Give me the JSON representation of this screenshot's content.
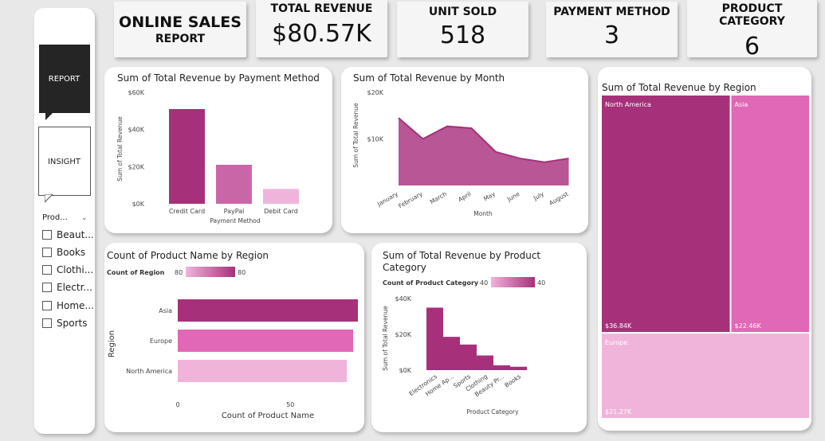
{
  "nav": {
    "report_label": "REPORT",
    "insight_label": "INSIGHT"
  },
  "slicer": {
    "header": "Prod...",
    "items": [
      "Beaut...",
      "Books",
      "Clothi...",
      "Electr...",
      "Home...",
      "Sports"
    ]
  },
  "report_title": {
    "line1": "ONLINE SALES",
    "line2": "REPORT"
  },
  "kpis": [
    {
      "label": "TOTAL REVENUE",
      "value": "$80.57K"
    },
    {
      "label": "UNIT SOLD",
      "value": "518"
    },
    {
      "label": "PAYMENT METHOD",
      "value": "3"
    },
    {
      "label": "PRODUCT CATEGORY",
      "value": "6"
    }
  ],
  "colors": {
    "dark": "#a6317a",
    "mid": "#e068b6",
    "light": "#f0b4db",
    "medium": "#c966a8"
  },
  "chart_data": [
    {
      "type": "bar",
      "title": "Sum of Total Revenue by Payment Method",
      "xlabel": "Payment Method",
      "ylabel": "Sum of Total Revenue",
      "categories": [
        "Credit Card",
        "PayPal",
        "Debit Card"
      ],
      "values": [
        51000,
        21000,
        8000
      ],
      "ylim": [
        0,
        60000
      ],
      "yticks": [
        "$0K",
        "$20K",
        "$40K",
        "$60K"
      ]
    },
    {
      "type": "area",
      "title": "Sum of Total Revenue by Month",
      "xlabel": "Month",
      "ylabel": "Sum of Total Revenue",
      "categories": [
        "January",
        "February",
        "March",
        "April",
        "May",
        "June",
        "July",
        "August"
      ],
      "values": [
        14500,
        10000,
        12700,
        12300,
        7200,
        5800,
        5000,
        5800
      ],
      "ylim": [
        0,
        20000
      ],
      "yticks": [
        "$10K",
        "$20K"
      ]
    },
    {
      "type": "heatmap",
      "title": "Sum of Total Revenue by Region",
      "categories": [
        "North America",
        "Asia",
        "Europe"
      ],
      "values": [
        36840,
        22460,
        21270
      ],
      "value_labels": [
        "$36.84K",
        "$22.46K",
        "$21.27K"
      ]
    },
    {
      "type": "bar",
      "title": "Count of Product Name by Region",
      "xlabel": "Count of Product Name",
      "ylabel": "Region",
      "legend_title": "Count of Region",
      "legend_min": "80",
      "legend_max": "80",
      "categories": [
        "Asia",
        "Europe",
        "North America"
      ],
      "values": [
        80,
        80,
        80
      ],
      "xticks": [
        "0",
        "50"
      ],
      "xlim": [
        0,
        80
      ]
    },
    {
      "type": "bar",
      "title": "Sum of Total Revenue by Product Category",
      "xlabel": "Product Category",
      "ylabel": "Sum of Total Revenue",
      "legend_title": "Count of Product Category",
      "legend_min": "40",
      "legend_max": "40",
      "categories": [
        "Electronics",
        "Home Ap...",
        "Sports",
        "Clothing",
        "Beauty Pr...",
        "Books"
      ],
      "values": [
        34900,
        18600,
        14300,
        8200,
        2700,
        1900
      ],
      "ylim": [
        0,
        40000
      ],
      "yticks": [
        "$0K",
        "$20K",
        "$40K"
      ]
    }
  ]
}
